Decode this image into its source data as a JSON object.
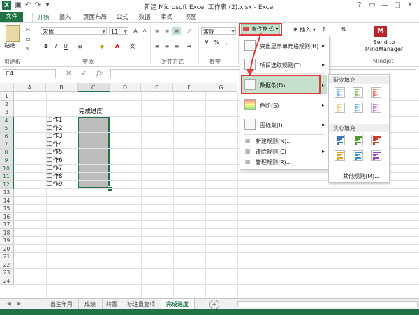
{
  "window": {
    "title": "新建 Microsoft Excel 工作表 (2).xlsx - Excel",
    "help_icon": "?",
    "restore_icon": "▭",
    "minimize_icon": "—",
    "maximize_icon": "□",
    "close_icon": "✕"
  },
  "ribbon_tabs": [
    "文件",
    "开始",
    "插入",
    "页面布局",
    "公式",
    "数据",
    "审阅",
    "视图"
  ],
  "ribbon": {
    "paste_label": "粘贴",
    "font_name": "宋体",
    "font_size": "11",
    "number_format": "常规",
    "cond_format_label": "条件格式",
    "insert_label": "插入",
    "send_to_label_1": "Send to",
    "send_to_label_2": "MindManager",
    "groups": {
      "clipboard": "剪贴板",
      "font": "字体",
      "alignment": "对齐方式",
      "number": "数字",
      "mindjet": "Mindjet"
    }
  },
  "formula_bar": {
    "name_box": "C4",
    "fx": "fx",
    "cancel_icon": "✕",
    "enter_icon": "✓"
  },
  "columns": [
    "A",
    "B",
    "C",
    "D",
    "E",
    "F",
    "G"
  ],
  "rows": [
    "1",
    "2",
    "3",
    "4",
    "5",
    "6",
    "7",
    "8",
    "9",
    "10",
    "11",
    "12",
    "13",
    "14",
    "15",
    "16",
    "17",
    "18",
    "19",
    "20",
    "21",
    "22",
    "23",
    "24"
  ],
  "cells": {
    "header": "完成进度",
    "tasks": [
      "工作1",
      "工作2",
      "工作3",
      "工作4",
      "工作5",
      "工作6",
      "工作7",
      "工作8",
      "工作9"
    ]
  },
  "sheets": [
    "出生年月",
    "成绩",
    "转置",
    "标注重复项",
    "完成进度"
  ],
  "active_sheet": "完成进度",
  "cond_format_menu": {
    "items": [
      "突出显示单元格规则(H)",
      "项目选取规则(T)",
      "数据条(D)",
      "色阶(S)",
      "图标集(I)"
    ],
    "actions": [
      "新建规则(N)...",
      "清除规则(C)",
      "管理规则(R)..."
    ]
  },
  "databar_submenu": {
    "gradient_label": "渐变填充",
    "solid_label": "实心填充",
    "more_rules": "其他规则(M)..."
  },
  "colors": {
    "excel_green": "#217346",
    "highlight_red": "#e03a3a",
    "selection_fill": "#bcbcbc",
    "menu_highlight": "#c5e1cd"
  }
}
